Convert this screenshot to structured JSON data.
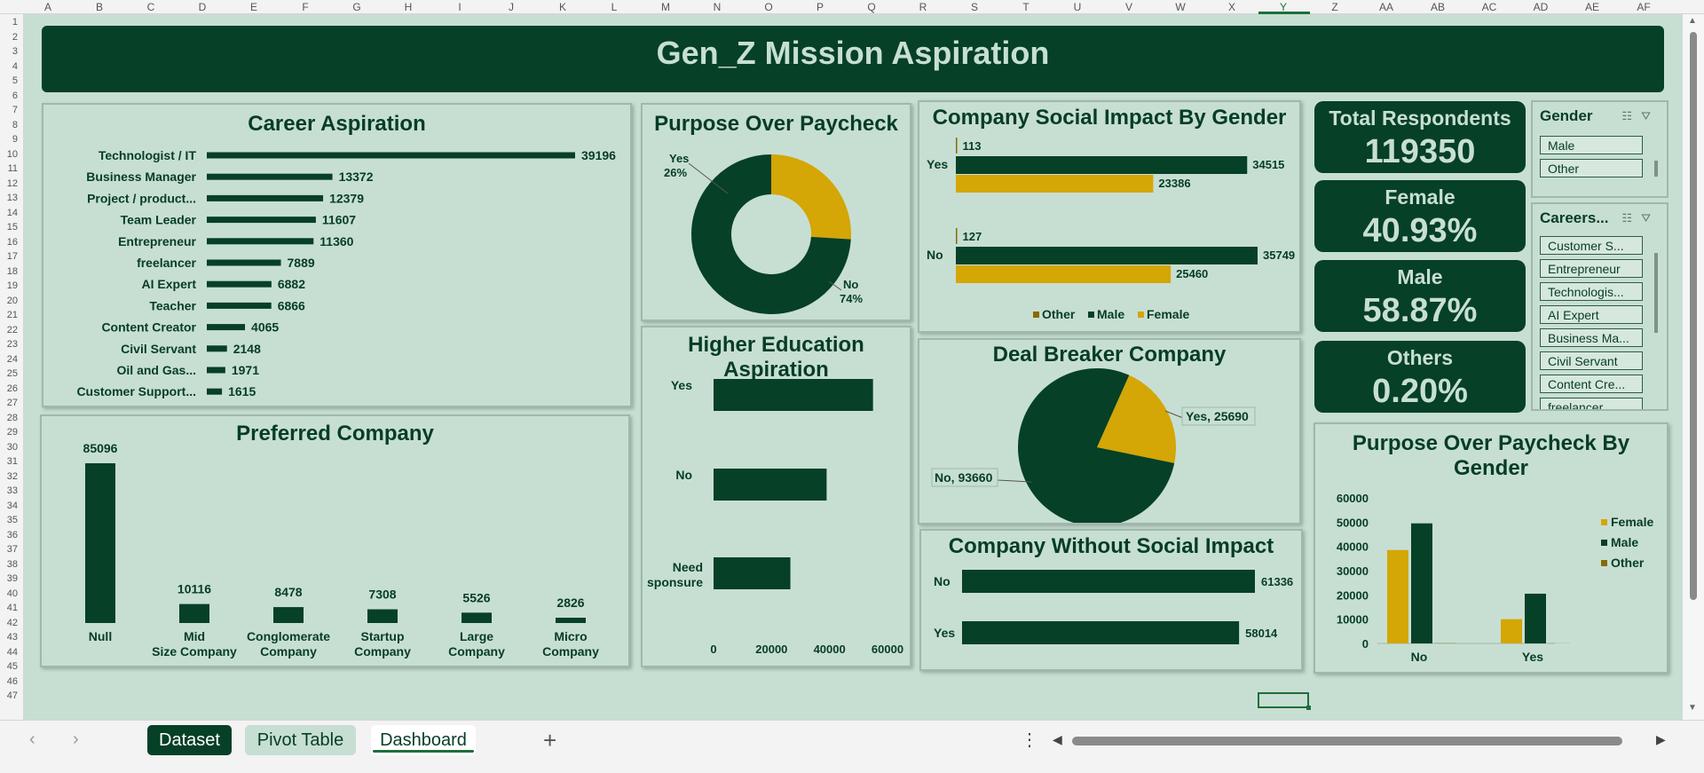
{
  "columns": [
    "A",
    "B",
    "C",
    "D",
    "E",
    "F",
    "G",
    "H",
    "I",
    "J",
    "K",
    "L",
    "M",
    "N",
    "O",
    "P",
    "Q",
    "R",
    "S",
    "T",
    "U",
    "V",
    "W",
    "X",
    "Y",
    "Z",
    "AA",
    "AB",
    "AC",
    "AD",
    "AE",
    "AF"
  ],
  "selected_column": "Y",
  "rows": [
    "1",
    "2",
    "3",
    "4",
    "5",
    "6",
    "7",
    "8",
    "9",
    "10",
    "11",
    "12",
    "13",
    "14",
    "15",
    "16",
    "17",
    "18",
    "19",
    "20",
    "21",
    "22",
    "23",
    "24",
    "25",
    "26",
    "27",
    "28",
    "29",
    "30",
    "31",
    "32",
    "33",
    "34",
    "35",
    "36",
    "37",
    "38",
    "39",
    "40",
    "41",
    "42",
    "43",
    "44",
    "45",
    "46",
    "47"
  ],
  "dashboard": {
    "title": "Gen_Z Mission Aspiration",
    "career": {
      "title": "Career Aspiration"
    },
    "purpose": {
      "title": "Purpose Over Paycheck"
    },
    "social_gender": {
      "title": "Company Social Impact By Gender"
    },
    "preferred": {
      "title": "Preferred Company"
    },
    "higher_ed": {
      "title_line1": "Higher Education",
      "title_line2": "Aspiration"
    },
    "deal": {
      "title": "Deal Breaker Company"
    },
    "no_social": {
      "title": "Company Without Social Impact"
    },
    "purpose_gender": {
      "title_line1": "Purpose Over Paycheck By",
      "title_line2": "Gender"
    }
  },
  "kpis": {
    "total": {
      "label": "Total Respondents",
      "value": "119350"
    },
    "female": {
      "label": "Female",
      "value": "40.93%"
    },
    "male": {
      "label": "Male",
      "value": "58.87%"
    },
    "others": {
      "label": "Others",
      "value": "0.20%"
    }
  },
  "slicers": {
    "gender": {
      "title": "Gender",
      "items": [
        "Male",
        "Other"
      ]
    },
    "careers": {
      "title": "Careers...",
      "items": [
        "Customer S...",
        "Entrepreneur",
        "Technologis...",
        "AI Expert",
        "Business Ma...",
        "Civil Servant",
        "Content Cre...",
        "freelancer"
      ]
    }
  },
  "chart_data": [
    {
      "type": "bar",
      "orientation": "horizontal",
      "title": "Career Aspiration",
      "categories": [
        "Technologist / IT",
        "Business Manager",
        "Project / product...",
        "Team Leader",
        "Entrepreneur",
        "freelancer",
        "AI Expert",
        "Teacher",
        "Content Creator",
        "Civil Servant",
        "Oil and Gas...",
        "Customer Support..."
      ],
      "values": [
        39196,
        13372,
        12379,
        11607,
        11360,
        7889,
        6882,
        6866,
        4065,
        2148,
        1971,
        1615
      ],
      "colors": [
        "#064026"
      ]
    },
    {
      "type": "pie",
      "subtype": "doughnut",
      "title": "Purpose Over Paycheck",
      "labels": [
        "Yes",
        "No"
      ],
      "values": [
        26,
        74
      ],
      "value_labels": [
        "26%",
        "74%"
      ],
      "colors": [
        "#d4a606",
        "#064026"
      ]
    },
    {
      "type": "bar",
      "orientation": "horizontal",
      "title": "Company Social Impact By Gender",
      "categories": [
        "Yes",
        "No"
      ],
      "series": [
        {
          "name": "Other",
          "values": [
            113,
            127
          ],
          "color": "#8a6a00"
        },
        {
          "name": "Male",
          "values": [
            34515,
            35749
          ],
          "color": "#064026"
        },
        {
          "name": "Female",
          "values": [
            23386,
            25460
          ],
          "color": "#d4a606"
        }
      ],
      "legend": "bottom"
    },
    {
      "type": "bar",
      "title": "Preferred Company",
      "categories": [
        "Null",
        "Mid Size Company",
        "Conglomerate Company",
        "Startup Company",
        "Large Company",
        "Micro Company"
      ],
      "values": [
        85096,
        10116,
        8478,
        7308,
        5526,
        2826
      ],
      "colors": [
        "#064026"
      ]
    },
    {
      "type": "bar",
      "orientation": "horizontal",
      "title": "Higher Education Aspiration",
      "categories": [
        "Yes",
        "No",
        "Need sponsure"
      ],
      "values": [
        55000,
        39000,
        26500
      ],
      "xlim": [
        0,
        60000
      ],
      "x_ticks": [
        "0",
        "20000",
        "40000",
        "60000"
      ],
      "colors": [
        "#064026"
      ]
    },
    {
      "type": "pie",
      "title": "Deal Breaker Company",
      "labels": [
        "Yes",
        "No"
      ],
      "values": [
        25690,
        93660
      ],
      "value_labels": [
        "Yes, 25690",
        "No, 93660"
      ],
      "colors": [
        "#d4a606",
        "#064026"
      ]
    },
    {
      "type": "bar",
      "orientation": "horizontal",
      "title": "Company Without Social Impact",
      "categories": [
        "No",
        "Yes"
      ],
      "values": [
        61336,
        58014
      ],
      "colors": [
        "#064026"
      ]
    },
    {
      "type": "bar",
      "title": "Purpose Over Paycheck By Gender",
      "categories": [
        "No",
        "Yes"
      ],
      "series": [
        {
          "name": "Female",
          "values": [
            38500,
            10000
          ],
          "color": "#d4a606"
        },
        {
          "name": "Male",
          "values": [
            49500,
            20500
          ],
          "color": "#064026"
        },
        {
          "name": "Other",
          "values": [
            100,
            50
          ],
          "color": "#8a6a00"
        }
      ],
      "ylim": [
        0,
        60000
      ],
      "y_ticks": [
        "0",
        "10000",
        "20000",
        "30000",
        "40000",
        "50000",
        "60000"
      ],
      "legend": "right"
    }
  ],
  "tabs": [
    {
      "label": "Dataset"
    },
    {
      "label": "Pivot Table"
    },
    {
      "label": "Dashboard"
    }
  ],
  "icons": {
    "prev": "‹",
    "next": "›",
    "add": "+",
    "more": "⋮",
    "scroll_left": "◀",
    "scroll_right": "▶"
  }
}
